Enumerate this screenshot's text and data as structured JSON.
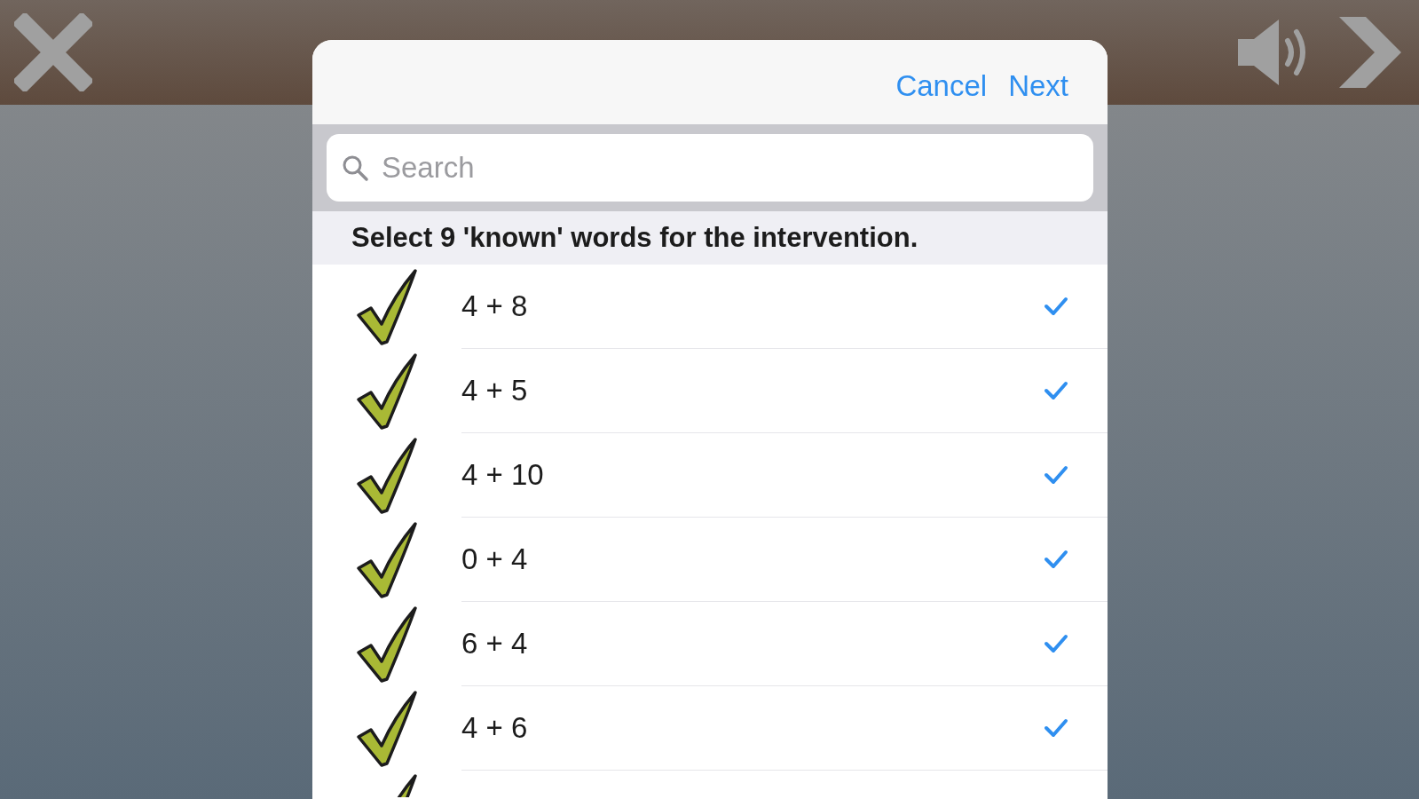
{
  "dialog": {
    "actions": [
      {
        "label": "Cancel"
      },
      {
        "label": "Next"
      }
    ],
    "search": {
      "placeholder": "Search"
    },
    "instruction": "Select 9 'known' words for the intervention.",
    "rows": [
      {
        "label": "4 + 8",
        "selected": true
      },
      {
        "label": "4 + 5",
        "selected": true
      },
      {
        "label": "4 + 10",
        "selected": true
      },
      {
        "label": "0 + 4",
        "selected": true
      },
      {
        "label": "6 + 4",
        "selected": true
      },
      {
        "label": "4 + 6",
        "selected": true
      }
    ],
    "more_rows_below": true
  }
}
